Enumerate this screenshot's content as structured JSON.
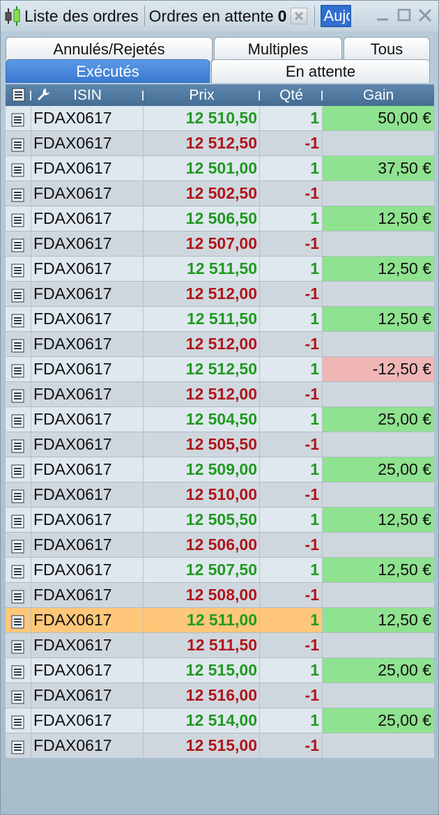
{
  "titlebar": {
    "title": "Liste des ordres",
    "pending_label": "Ordres en attente",
    "pending_count": "0",
    "period_value": "Aujourd'hui",
    "icons": [
      "candlestick-icon",
      "clear-icon",
      "minimize-icon",
      "maximize-icon",
      "close-icon"
    ]
  },
  "tabs": {
    "annules": "Annulés/Rejetés",
    "multiples": "Multiples",
    "tous": "Tous",
    "executes": "Exécutés",
    "en_attente": "En attente",
    "active": "Exécutés"
  },
  "table": {
    "headers": {
      "isin": "ISIN",
      "prix": "Prix",
      "qte": "Qté",
      "gain": "Gain"
    },
    "rows": [
      {
        "isin": "FDAX0617",
        "prix": "12 510,50",
        "qte": "1",
        "gain": "50,00 €",
        "side": "buy"
      },
      {
        "isin": "FDAX0617",
        "prix": "12 512,50",
        "qte": "-1",
        "gain": "",
        "side": "sell"
      },
      {
        "isin": "FDAX0617",
        "prix": "12 501,00",
        "qte": "1",
        "gain": "37,50 €",
        "side": "buy"
      },
      {
        "isin": "FDAX0617",
        "prix": "12 502,50",
        "qte": "-1",
        "gain": "",
        "side": "sell"
      },
      {
        "isin": "FDAX0617",
        "prix": "12 506,50",
        "qte": "1",
        "gain": "12,50 €",
        "side": "buy"
      },
      {
        "isin": "FDAX0617",
        "prix": "12 507,00",
        "qte": "-1",
        "gain": "",
        "side": "sell"
      },
      {
        "isin": "FDAX0617",
        "prix": "12 511,50",
        "qte": "1",
        "gain": "12,50 €",
        "side": "buy"
      },
      {
        "isin": "FDAX0617",
        "prix": "12 512,00",
        "qte": "-1",
        "gain": "",
        "side": "sell"
      },
      {
        "isin": "FDAX0617",
        "prix": "12 511,50",
        "qte": "1",
        "gain": "12,50 €",
        "side": "buy"
      },
      {
        "isin": "FDAX0617",
        "prix": "12 512,00",
        "qte": "-1",
        "gain": "",
        "side": "sell"
      },
      {
        "isin": "FDAX0617",
        "prix": "12 512,50",
        "qte": "1",
        "gain": "-12,50 €",
        "side": "buy"
      },
      {
        "isin": "FDAX0617",
        "prix": "12 512,00",
        "qte": "-1",
        "gain": "",
        "side": "sell"
      },
      {
        "isin": "FDAX0617",
        "prix": "12 504,50",
        "qte": "1",
        "gain": "25,00 €",
        "side": "buy"
      },
      {
        "isin": "FDAX0617",
        "prix": "12 505,50",
        "qte": "-1",
        "gain": "",
        "side": "sell"
      },
      {
        "isin": "FDAX0617",
        "prix": "12 509,00",
        "qte": "1",
        "gain": "25,00 €",
        "side": "buy"
      },
      {
        "isin": "FDAX0617",
        "prix": "12 510,00",
        "qte": "-1",
        "gain": "",
        "side": "sell"
      },
      {
        "isin": "FDAX0617",
        "prix": "12 505,50",
        "qte": "1",
        "gain": "12,50 €",
        "side": "buy"
      },
      {
        "isin": "FDAX0617",
        "prix": "12 506,00",
        "qte": "-1",
        "gain": "",
        "side": "sell"
      },
      {
        "isin": "FDAX0617",
        "prix": "12 507,50",
        "qte": "1",
        "gain": "12,50 €",
        "side": "buy"
      },
      {
        "isin": "FDAX0617",
        "prix": "12 508,00",
        "qte": "-1",
        "gain": "",
        "side": "sell"
      },
      {
        "isin": "FDAX0617",
        "prix": "12 511,00",
        "qte": "1",
        "gain": "12,50 €",
        "side": "buy",
        "selected": true
      },
      {
        "isin": "FDAX0617",
        "prix": "12 511,50",
        "qte": "-1",
        "gain": "",
        "side": "sell"
      },
      {
        "isin": "FDAX0617",
        "prix": "12 515,00",
        "qte": "1",
        "gain": "25,00 €",
        "side": "buy"
      },
      {
        "isin": "FDAX0617",
        "prix": "12 516,00",
        "qte": "-1",
        "gain": "",
        "side": "sell"
      },
      {
        "isin": "FDAX0617",
        "prix": "12 514,00",
        "qte": "1",
        "gain": "25,00 €",
        "side": "buy"
      },
      {
        "isin": "FDAX0617",
        "prix": "12 515,00",
        "qte": "-1",
        "gain": "",
        "side": "sell"
      }
    ]
  },
  "colors": {
    "buy": "#1f9a1f",
    "sell": "#b0141a",
    "gain_positive_bg": "#8fe28f",
    "gain_negative_bg": "#f0b6b6",
    "selected_row": "#ffc77a",
    "header_bg": "#4f789f",
    "active_tab": "#4a88dc"
  }
}
